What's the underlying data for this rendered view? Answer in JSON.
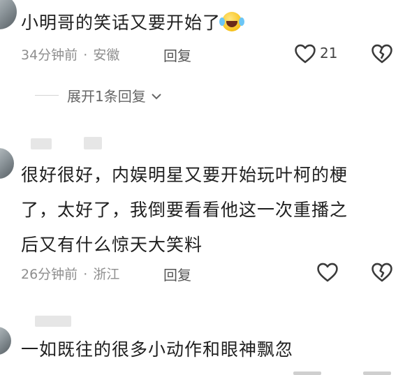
{
  "comment1": {
    "text": "小明哥的笑话又要开始了",
    "emoji": "rolling-on-floor-laughing-emoji",
    "time": "34分钟前",
    "sep": "·",
    "location": "安徽",
    "reply": "回复",
    "likes": "21"
  },
  "expand": {
    "label": "展开1条回复"
  },
  "comment2": {
    "text_lines": [
      "很好很好，内娱明星又要开始玩叶柯的梗",
      "了，太好了，我倒要看看他这一次重播之",
      "后又有什么惊天大笑料"
    ],
    "time": "26分钟前",
    "sep": "·",
    "location": "浙江",
    "reply": "回复"
  },
  "comment3": {
    "text": "一如既往的很多小动作和眼神飘忽"
  },
  "colors": {
    "text": "#1f1f1f",
    "meta": "#8e8e8e",
    "icon": "#3a3a3a",
    "divider": "#d4d4d4"
  }
}
